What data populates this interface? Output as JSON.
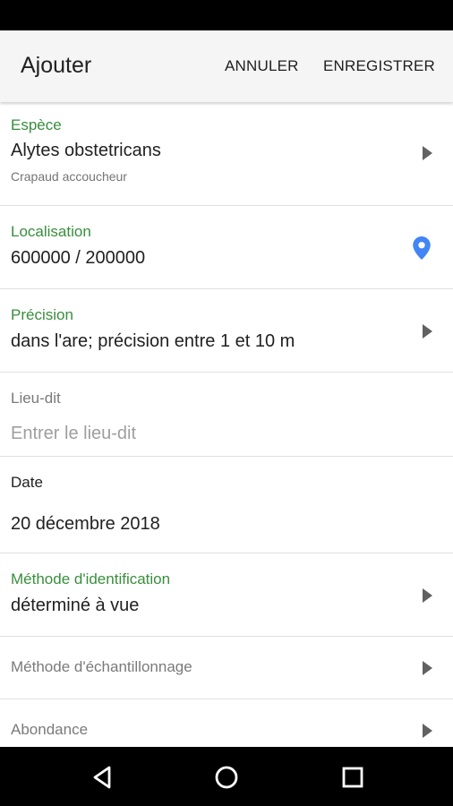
{
  "app_bar": {
    "title": "Ajouter",
    "cancel_label": "ANNULER",
    "save_label": "ENREGISTRER"
  },
  "form": {
    "espece": {
      "label": "Espèce",
      "value": "Alytes obstetricans",
      "common_name": "Crapaud accoucheur"
    },
    "localisation": {
      "label": "Localisation",
      "value": "600000 / 200000",
      "icon": "location-pin-icon"
    },
    "precision": {
      "label": "Précision",
      "value": "dans l'are; précision entre 1 et 10 m"
    },
    "lieu_dit": {
      "label": "Lieu-dit",
      "placeholder": "Entrer le lieu-dit"
    },
    "date": {
      "label": "Date",
      "value": "20 décembre 2018"
    },
    "methode_identification": {
      "label": "Méthode d'identification",
      "value": "déterminé à vue"
    },
    "methode_echantillonnage": {
      "label": "Méthode d'échantillonnage"
    },
    "abondance": {
      "label": "Abondance"
    }
  },
  "nav": {
    "icons": [
      "back-icon",
      "home-icon",
      "recents-icon"
    ]
  },
  "colors": {
    "accent_green": "#388e3c",
    "pin_blue": "#4285f4",
    "app_bar_bg": "#f5f5f5"
  }
}
